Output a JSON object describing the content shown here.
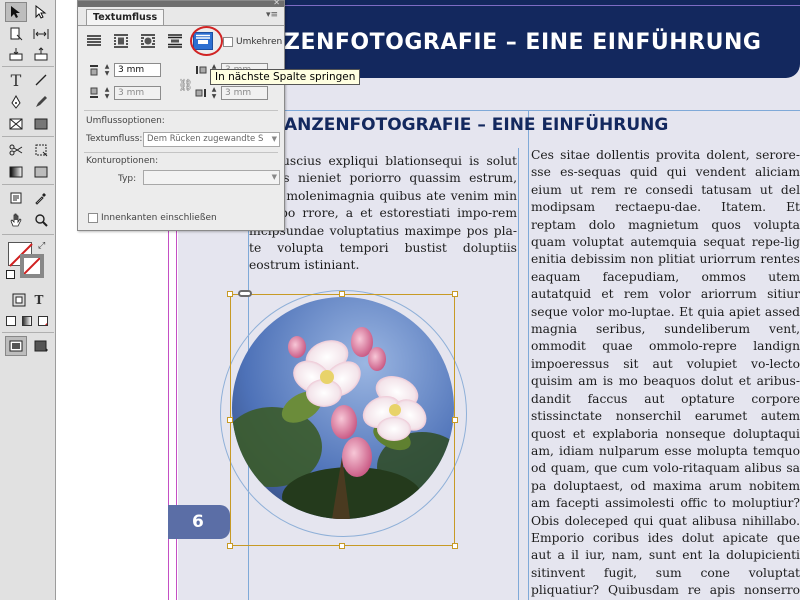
{
  "tools": {
    "type_tool_glyph": "T",
    "swatch_type_glyph": "T"
  },
  "panel": {
    "title": "Textumfluss",
    "menu_glyph": "▾≡",
    "close_glyph": "✕",
    "wrap_options": [
      {
        "name": "Kein Textumfluss"
      },
      {
        "name": "Umfließen: Begrenzungsrahmen"
      },
      {
        "name": "Umfließen: Objektform"
      },
      {
        "name": "Objekt überspringen"
      },
      {
        "name": "In nächste Spalte springen",
        "active": true
      }
    ],
    "invert_label": "Umkehren",
    "offsets": {
      "top": "3 mm",
      "bottom": "3 mm",
      "left": "3 mm",
      "right": "3 mm"
    },
    "wrap_options_heading": "Umflussoptionen:",
    "wrap_to_label": "Textumfluss:",
    "wrap_to_value": "Dem Rücken zugewandte S",
    "contour_heading": "Konturoptionen:",
    "contour_type_label": "Typ:",
    "contour_type_value": "",
    "include_inside_edges_label": "Innenkanten einschließen"
  },
  "tooltip": "In nächste Spalte springen",
  "document": {
    "header_title": "ZENFOTOGRAFIE – EINE EINFÜHRUNG",
    "subtitle": "ANZENFOTOGRAFIE – EINE EINFÜHRUNG",
    "page_number": "6",
    "column1_text": "ate suscius expliqui blationsequi is solut ost as nieniet poriorro quassim estrum, labor molenimagnia quibus ate venim min nullabo rrore, a et estorestiati impo-rem incipsundae voluptatius maximpe pos pla-te volupta tempori bustist doluptiis eostrum istiniant.",
    "column2_text": "Ces sitae dollentis provita dolent, serore-sse es-sequas quid qui vendent aliciam eium ut rem re consedi tatusam ut del modipsam rectaepu-dae. Itatem. Et reptam dolo magnietum quos volupta quam voluptat autemquia sequat repe-lig enitia debissim non plitiat uriorrum rentes eaquam facepudiam, ommos utem autatquid et rem volor ariorrum sitiur seque volor mo-luptae. Et quia apiet assed magnia seribus, sundeliberum vent, ommodit quae ommolo-repre landign impoeressus sit aut volupiet vo-lecto quisim am is mo beaquos dolut et aribus-dandit faccus aut optature corpore stissinctate nonserchil earumet autem quost et explaboria nonseque doluptaqui am, idiam nulparum esse molupta temquo od quam, que cum volo-ritaquam alibus sa pa doluptaest, od maxima arum nobitem am facepti assimolesti offic to moluptiur? Obis doleceped qui quat alibusa nihillabo. Emporio coribus ides dolut apicate que aut a il iur, nam, sunt ent la dolupicienti sitinvent fugit, sum cone voluptat pliquatiur? Quibusdam re apis nonserro magnam, abo. Ut aut et doloreribus evendae rspicil litatur ese-nis anihillori consedi berrum sinvenimusam imus dolentorem re plibus quae volores tions-"
  },
  "colors": {
    "header_blue": "#13285e",
    "page_tint": "#e5e5ef",
    "frame_gold": "#c79a25",
    "guide_magenta": "#c44fc4",
    "guide_blue": "#8fb0d8",
    "highlight_red": "#d12424",
    "tooltip_bg": "#ffffe1"
  }
}
